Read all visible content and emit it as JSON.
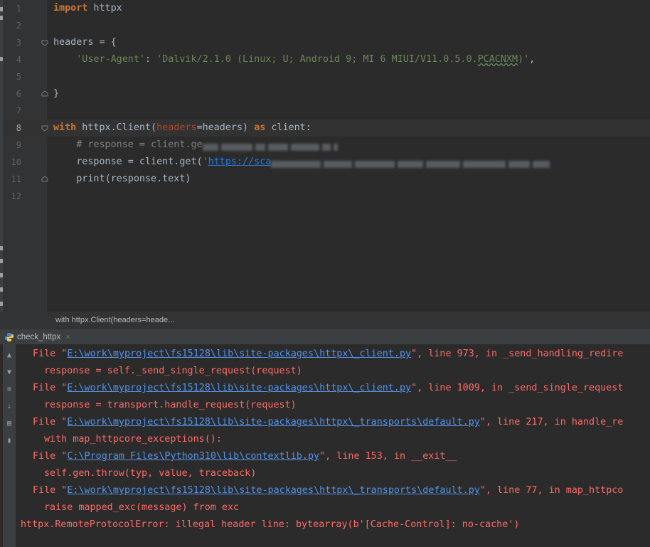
{
  "editor": {
    "lines": [
      {
        "n": "1",
        "parts": [
          {
            "t": "import",
            "c": "kw"
          },
          {
            "t": " httpx",
            "c": ""
          }
        ]
      },
      {
        "n": "2",
        "parts": []
      },
      {
        "n": "3",
        "parts": [
          {
            "t": "headers = {",
            "c": ""
          }
        ]
      },
      {
        "n": "4",
        "parts": [
          {
            "t": "    'User-Agent'",
            "c": "str"
          },
          {
            "t": ": ",
            "c": ""
          },
          {
            "t": "'Dalvik/2.1.0 (Linux; U; Android 9; MI 6 MIUI/V11.0.5.0.",
            "c": "str"
          },
          {
            "t": "PCACNXM",
            "c": "str typo"
          },
          {
            "t": ")'",
            "c": "str"
          },
          {
            "t": ",",
            "c": ""
          }
        ]
      },
      {
        "n": "5",
        "parts": []
      },
      {
        "n": "6",
        "parts": [
          {
            "t": "}",
            "c": ""
          }
        ]
      },
      {
        "n": "7",
        "parts": []
      },
      {
        "n": "8",
        "parts": [
          {
            "t": "with",
            "c": "kw"
          },
          {
            "t": " httpx.Client(",
            "c": ""
          },
          {
            "t": "headers",
            "c": "param"
          },
          {
            "t": "=headers) ",
            "c": ""
          },
          {
            "t": "as",
            "c": "kw"
          },
          {
            "t": " client:",
            "c": ""
          }
        ]
      },
      {
        "n": "9",
        "parts": [
          {
            "t": "    # response = client.ge",
            "c": "cmt"
          }
        ]
      },
      {
        "n": "10",
        "parts": [
          {
            "t": "    response = client.get(",
            "c": ""
          },
          {
            "t": "'",
            "c": "str"
          },
          {
            "t": "https://sca",
            "c": "url"
          }
        ]
      },
      {
        "n": "11",
        "parts": [
          {
            "t": "    ",
            "c": ""
          },
          {
            "t": "print",
            "c": ""
          },
          {
            "t": "(response.text)",
            "c": ""
          }
        ]
      },
      {
        "n": "12",
        "parts": []
      }
    ]
  },
  "breadcrumb": {
    "text": "with httpx.Client(headers=heade..."
  },
  "run_panel": {
    "tab_label": "check_httpx",
    "close_glyph": "×"
  },
  "console": {
    "lines": [
      {
        "indent": 1,
        "parts": [
          {
            "t": "File \"",
            "c": ""
          },
          {
            "t": "E:\\work\\myproject\\fs15128\\lib\\site-packages\\httpx\\_client.py",
            "c": "clink"
          },
          {
            "t": "\", line 973, in _send_handling_redire",
            "c": ""
          }
        ]
      },
      {
        "indent": 2,
        "parts": [
          {
            "t": "response = self._send_single_request(request)",
            "c": ""
          }
        ]
      },
      {
        "indent": 1,
        "parts": [
          {
            "t": "File \"",
            "c": ""
          },
          {
            "t": "E:\\work\\myproject\\fs15128\\lib\\site-packages\\httpx\\_client.py",
            "c": "clink"
          },
          {
            "t": "\", line 1009, in _send_single_request",
            "c": ""
          }
        ]
      },
      {
        "indent": 2,
        "parts": [
          {
            "t": "response = transport.handle_request(request)",
            "c": ""
          }
        ]
      },
      {
        "indent": 1,
        "parts": [
          {
            "t": "File \"",
            "c": ""
          },
          {
            "t": "E:\\work\\myproject\\fs15128\\lib\\site-packages\\httpx\\_transports\\default.py",
            "c": "clink"
          },
          {
            "t": "\", line 217, in handle_re",
            "c": ""
          }
        ]
      },
      {
        "indent": 2,
        "parts": [
          {
            "t": "with map_httpcore_exceptions():",
            "c": ""
          }
        ]
      },
      {
        "indent": 1,
        "parts": [
          {
            "t": "File \"",
            "c": ""
          },
          {
            "t": "C:\\Program Files\\Python310\\lib\\contextlib.py",
            "c": "clink"
          },
          {
            "t": "\", line 153, in __exit__",
            "c": ""
          }
        ]
      },
      {
        "indent": 2,
        "parts": [
          {
            "t": "self.gen.throw(typ, value, traceback)",
            "c": ""
          }
        ]
      },
      {
        "indent": 1,
        "parts": [
          {
            "t": "File \"",
            "c": ""
          },
          {
            "t": "E:\\work\\myproject\\fs15128\\lib\\site-packages\\httpx\\_transports\\default.py",
            "c": "clink"
          },
          {
            "t": "\", line 77, in map_httpco",
            "c": ""
          }
        ]
      },
      {
        "indent": 2,
        "parts": [
          {
            "t": "raise mapped_exc(message) from exc",
            "c": ""
          }
        ]
      },
      {
        "indent": 0,
        "parts": [
          {
            "t": "httpx.RemoteProtocolError: illegal header line: bytearray(b'[Cache-Control]: no-cache')",
            "c": ""
          }
        ]
      }
    ]
  },
  "colors": {
    "background": "#2b2b2b",
    "keyword": "#cc7832",
    "string": "#6a8759",
    "error": "#ff6b68",
    "link": "#5394ec"
  }
}
